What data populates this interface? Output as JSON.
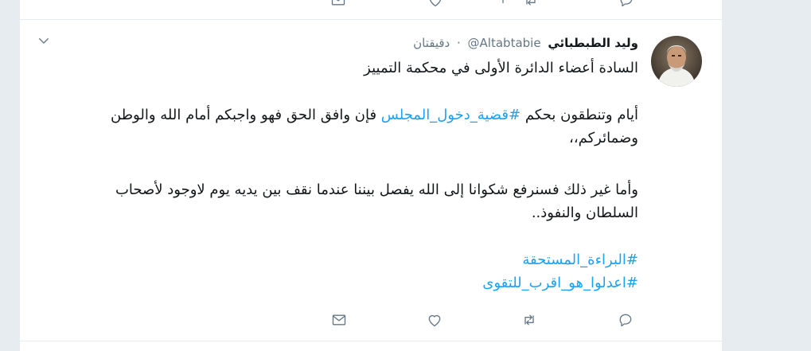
{
  "tweet": {
    "display_name": "وليد الطبطبائي",
    "handle": "@Altabtabie",
    "separator": "·",
    "time": "دقيقتان",
    "line1": "السادة أعضاء الدائرة الأولى في  محكمة التمييز",
    "line2_before": "أيام وتنطقون بحكم ",
    "line2_hashtag": "#قضية_دخول_المجلس",
    "line2_after": " فإن وافق الحق فهو واجبكم أمام الله والوطن",
    "line3": "وضمائركم،،",
    "line4": "وأما غير ذلك فسنرفع شكوانا إلى الله يفصل بيننا عندما نقف بين يديه يوم لاوجود لأصحاب",
    "line5": "السلطان والنفوذ..",
    "hashtag1": "#البراءة_المستحقة",
    "hashtag2": "#اعدلوا_هو_اقرب_للتقوى"
  },
  "icons": {
    "avatar": "avatar-photo",
    "caret": "chevron-down-icon",
    "dm": "envelope-icon",
    "like": "heart-icon",
    "retweet": "retweet-icon",
    "reply": "reply-bubble-icon"
  },
  "colors": {
    "link": "#1da1f2",
    "text": "#14171a",
    "muted": "#657786",
    "background": "#e6ecf0"
  }
}
